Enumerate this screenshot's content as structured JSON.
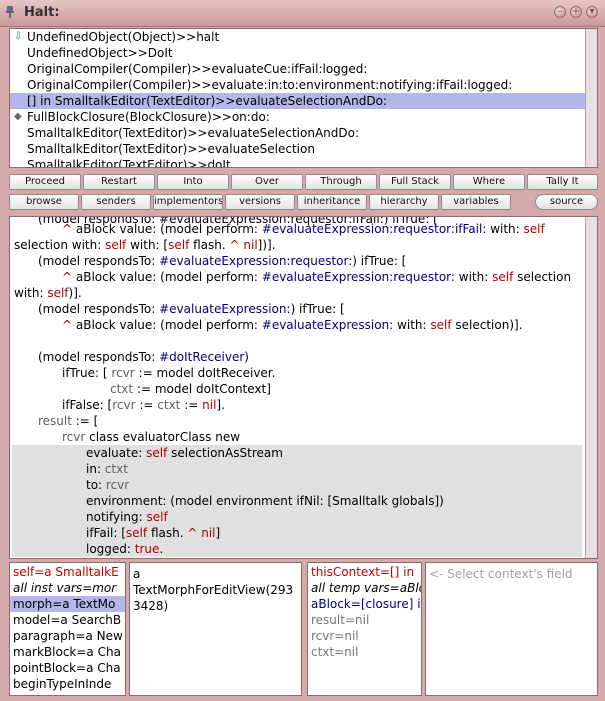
{
  "window": {
    "title": "Halt:"
  },
  "stack": {
    "items": [
      {
        "label": "UndefinedObject(Object)>>halt",
        "mark": "arrow"
      },
      {
        "label": "UndefinedObject>>DoIt",
        "mark": ""
      },
      {
        "label": "OriginalCompiler(Compiler)>>evaluateCue:ifFail:logged:",
        "mark": ""
      },
      {
        "label": "OriginalCompiler(Compiler)>>evaluate:in:to:environment:notifying:ifFail:logged:",
        "mark": ""
      },
      {
        "label": "[] in SmalltalkEditor(TextEditor)>>evaluateSelectionAndDo:",
        "mark": ""
      },
      {
        "label": "FullBlockClosure(BlockClosure)>>on:do:",
        "mark": "diamond"
      },
      {
        "label": "SmalltalkEditor(TextEditor)>>evaluateSelectionAndDo:",
        "mark": ""
      },
      {
        "label": "SmalltalkEditor(TextEditor)>>evaluateSelection",
        "mark": ""
      },
      {
        "label": "SmalltalkEditor(TextEditor)>>doIt",
        "mark": ""
      }
    ]
  },
  "toolbar1": [
    "Proceed",
    "Restart",
    "Into",
    "Over",
    "Through",
    "Full Stack",
    "Where",
    "Tally It"
  ],
  "toolbar2": [
    "browse",
    "senders",
    "implementors",
    "versions",
    "inheritance",
    "hierarchy",
    "variables",
    "source"
  ],
  "code": {
    "l0a": "(model respondsTo: #evaluateExpression:requestor:ifFail:) ifTrue: [",
    "l1a": "^ ",
    "l1b": "aBlock value: (model perform: ",
    "l1c": "#evaluateExpression:requestor:ifFail:",
    "l1d": " with: ",
    "l1e": "self",
    "l2a": "selection with: ",
    "l2b": "self",
    "l2c": " with: [",
    "l2d": "self",
    "l2e": " flash. ",
    "l2f": "^",
    "l2g": " nil",
    "l2h": "])].",
    "l3a": "(model respondsTo: ",
    "l3b": "#evaluateExpression:requestor:",
    "l3c": ") ifTrue: [",
    "l4a": "^ ",
    "l4b": "aBlock value: (model perform: ",
    "l4c": "#evaluateExpression:requestor:",
    "l4d": " with: ",
    "l4e": "self",
    "l4f": " selection",
    "l5a": "with: ",
    "l5b": "self",
    "l5c": ")].",
    "l6a": "(model respondsTo: ",
    "l6b": "#evaluateExpression:",
    "l6c": ") ifTrue: [",
    "l7a": "^ ",
    "l7b": "aBlock value: (model perform: ",
    "l7c": "#evaluateExpression:",
    "l7d": " with: ",
    "l7e": "self",
    "l7f": " selection",
    "l7g": ")].",
    "l8a": "(model respondsTo: ",
    "l8b": "#doItReceiver",
    "l8c": ")",
    "l9a": "ifTrue: [ ",
    "l9b": "rcvr",
    "l9c": " := model doItReceiver.",
    "l10a": "ctxt",
    "l10b": " := model doItContext]",
    "l11a": "ifFalse: [",
    "l11b": "rcvr",
    "l11c": " := ",
    "l11d": "ctxt",
    "l11e": " := ",
    "l11f": "nil",
    "l11g": "].",
    "l12a": "result",
    "l12b": " := [",
    "l13a": "rcvr",
    "l13b": " class evaluatorClass new",
    "l14a": "evaluate: ",
    "l14b": "self",
    "l14c": " selectionAsStream",
    "l15a": "in: ",
    "l15b": "ctxt",
    "l16a": "to: ",
    "l16b": "rcvr",
    "l17a": "environment: (model environment ifNil: [Smalltalk globals])",
    "l18a": "notifying: ",
    "l18b": "self",
    "l19a": "ifFail: [",
    "l19b": "self",
    "l19c": " flash. ",
    "l19d": "^",
    "l19e": " nil",
    "l19f": "]",
    "l20a": "logged: ",
    "l20b": "true",
    "l20c": "."
  },
  "receiver_fields": {
    "items": [
      "self=a SmalltalkE",
      "all inst vars=mor",
      "morph=a TextMo",
      "model=a SearchB",
      "paragraph=a New",
      "markBlock=a Cha",
      "pointBlock=a Cha",
      "beginTypeInInde"
    ]
  },
  "receiver_value": {
    "line1": "a",
    "line2": "TextMorphForEditView(293",
    "line3": "3428)"
  },
  "context_fields": {
    "items": [
      "thisContext=[] in",
      "all temp vars=aBlo",
      "aBlock=[closure] i",
      "result=nil",
      "rcvr=nil",
      "ctxt=nil"
    ]
  },
  "context_value": {
    "placeholder": "<- Select context's field"
  }
}
